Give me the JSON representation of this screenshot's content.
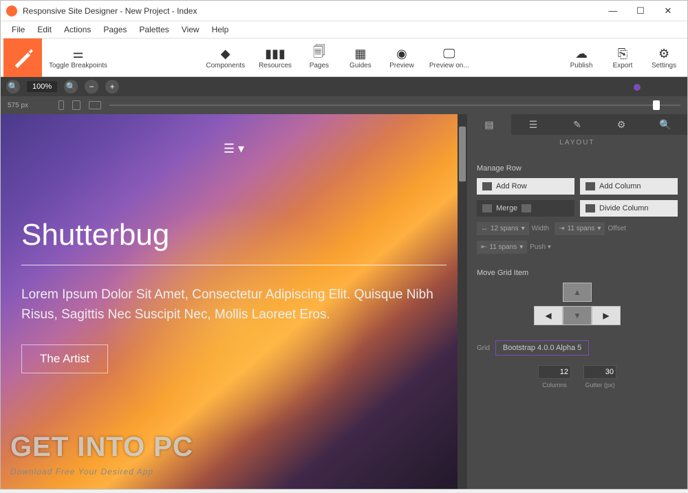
{
  "title": "Responsive Site Designer - New Project - Index",
  "menubar": [
    "File",
    "Edit",
    "Actions",
    "Pages",
    "Palettes",
    "View",
    "Help"
  ],
  "toolbar": {
    "toggle": "Toggle Breakpoints",
    "components": "Components",
    "resources": "Resources",
    "pages": "Pages",
    "guides": "Guides",
    "preview": "Preview",
    "preview_on": "Preview on...",
    "publish": "Publish",
    "export": "Export",
    "settings": "Settings"
  },
  "zoom": {
    "pct": "100%",
    "breakpoint": "575 px"
  },
  "canvas": {
    "heading": "Shutterbug",
    "body": "Lorem Ipsum Dolor Sit Amet, Consectetur Adipiscing Elit. Quisque Nibh Risus, Sagittis Nec Suscipit Nec, Mollis Laoreet Eros.",
    "button": "The Artist"
  },
  "inspector": {
    "section_title": "LAYOUT",
    "manage_row": "Manage Row",
    "add_row": "Add Row",
    "add_col": "Add Column",
    "merge": "Merge",
    "divide": "Divide Column",
    "spans1": "12 spans",
    "width": "Width",
    "spans2": "11 spans",
    "offset": "Offset",
    "spans3": "11 spans",
    "push": "Push",
    "move": "Move Grid Item",
    "grid": "Grid",
    "grid_val": "Bootstrap 4.0.0 Alpha 5",
    "cols": "12",
    "cols_lbl": "Columns",
    "gutter": "30",
    "gutter_lbl": "Gutter (px)"
  },
  "watermark": {
    "big": "GET INTO PC",
    "small": "Download Free Your Desired App"
  }
}
